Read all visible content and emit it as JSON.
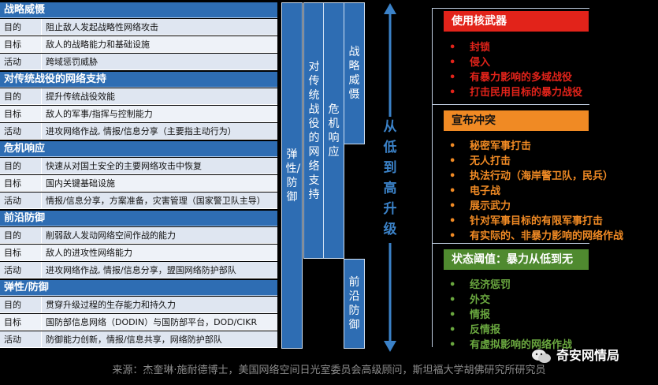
{
  "sections": [
    {
      "title": "战略威慑",
      "rows": [
        {
          "key": "目的",
          "value": "阻止敌人发起战略性网络攻击"
        },
        {
          "key": "目标",
          "value": "敌人的战略能力和基础设施"
        },
        {
          "key": "活动",
          "value": "跨域惩罚威胁"
        }
      ]
    },
    {
      "title": "对传统战役的网络支持",
      "rows": [
        {
          "key": "目的",
          "value": "提升传统战役效能"
        },
        {
          "key": "目标",
          "value": "敌人的军事/指挥与控制能力"
        },
        {
          "key": "活动",
          "value": "进攻网络作战, 情报/信息分享（主要指主动行为）"
        }
      ]
    },
    {
      "title": "危机响应",
      "rows": [
        {
          "key": "目的",
          "value": "快速从对国土安全的主要网络攻击中恢复"
        },
        {
          "key": "目标",
          "value": "国内关键基础设施"
        },
        {
          "key": "活动",
          "value": "情报/信息分享，方案准备，灾害管理（国家警卫队主导）"
        }
      ]
    },
    {
      "title": "前沿防御",
      "rows": [
        {
          "key": "目的",
          "value": "削弱敌人发动网络空间作战的能力"
        },
        {
          "key": "目标",
          "value": "敌人的进攻性网络能力"
        },
        {
          "key": "活动",
          "value": "进攻网络作战, 情报/信息分享，盟国网络防护部队"
        }
      ]
    },
    {
      "title": "弹性/防御",
      "rows": [
        {
          "key": "目的",
          "value": "贯穿升级过程的生存能力和持久力"
        },
        {
          "key": "目标",
          "value": "国防部信息网络（DODIN）与国防部平台，DOD/CIKR"
        },
        {
          "key": "活动",
          "value": "防御能力创新，情报/信息共享，网络防护部队"
        }
      ]
    }
  ],
  "columns": {
    "resilience": "弹性/防御",
    "conventional": "对传统战役的网络支持",
    "crisis": "危机响应",
    "deterrence": "战略威慑",
    "forward": "前沿防御"
  },
  "arrow_label": "从低到高升级",
  "levels": [
    {
      "title": "使用核武器",
      "color": "#e2231a",
      "text_color": "#ffffff",
      "items": [
        "封锁",
        "侵入",
        "有暴力影响的多域战役",
        "打击民用目标的暴力战役"
      ]
    },
    {
      "title": "宣布冲突",
      "color": "#f08a24",
      "text_color": "#111111",
      "items": [
        "秘密军事打击",
        "无人打击",
        "执法行动（海岸警卫队，民兵）",
        "电子战",
        "展示武力",
        "针对军事目标的有限军事打击",
        "有实际的、非暴力影响的网络作战"
      ]
    },
    {
      "title": "状态阈值：暴力从低到无",
      "color": "#4f8a2f",
      "text_color": "#ffffff",
      "items": [
        "经济惩罚",
        "外交",
        "情报",
        "反情报",
        "有虚拟影响的网络作战"
      ]
    }
  ],
  "bullet": "•",
  "watermark": "奇安网情局",
  "footer": "来源：杰奎琳·施耐德博士，美国网络空间日光室委员会高级顾问，斯坦福大学胡佛研究所研究员"
}
